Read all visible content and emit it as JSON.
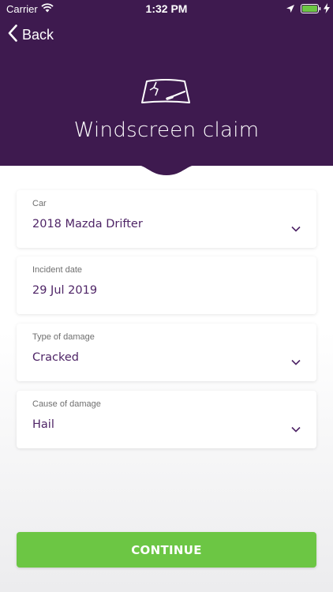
{
  "status_bar": {
    "carrier": "Carrier",
    "time": "1:32 PM",
    "icons": [
      "wifi-icon",
      "location-arrow-icon",
      "battery-icon",
      "charging-bolt-icon"
    ]
  },
  "nav": {
    "back_label": "Back",
    "back_icon": "chevron-left-icon"
  },
  "header": {
    "icon": "cracked-windscreen-icon",
    "title": "Windscreen claim",
    "background_color": "#3e1a4f"
  },
  "form": {
    "fields": [
      {
        "label": "Car",
        "value": "2018 Mazda Drifter",
        "type": "dropdown"
      },
      {
        "label": "Incident date",
        "value": "29 Jul 2019",
        "type": "date"
      },
      {
        "label": "Type of damage",
        "value": "Cracked",
        "type": "dropdown"
      },
      {
        "label": "Cause of damage",
        "value": "Hail",
        "type": "dropdown"
      }
    ],
    "value_color": "#4e2466"
  },
  "actions": {
    "continue_label": "CONTINUE",
    "continue_color": "#6cc644"
  }
}
